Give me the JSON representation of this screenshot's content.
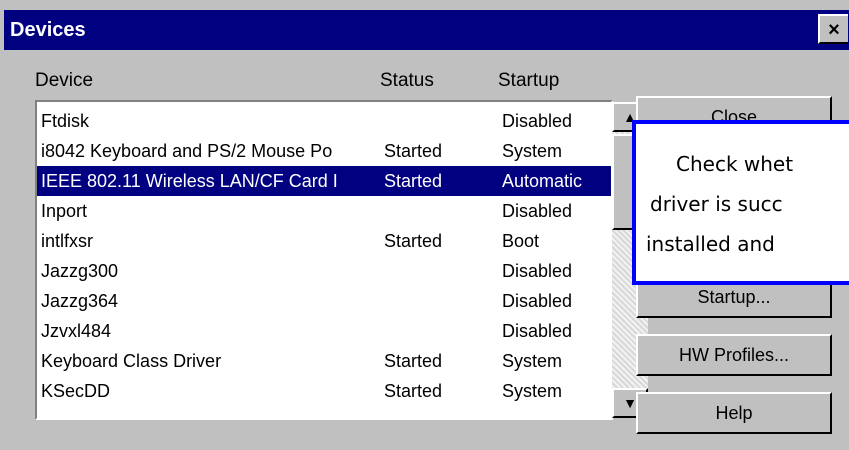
{
  "window": {
    "title": "Devices",
    "close_glyph": "×"
  },
  "columns": {
    "device": "Device",
    "status": "Status",
    "startup": "Startup"
  },
  "devices": [
    {
      "name": "Ftdisk",
      "status": "",
      "startup": "Disabled"
    },
    {
      "name": "i8042 Keyboard and PS/2 Mouse Po",
      "status": "Started",
      "startup": "System"
    },
    {
      "name": "IEEE 802.11 Wireless LAN/CF Card I",
      "status": "Started",
      "startup": "Automatic"
    },
    {
      "name": "Inport",
      "status": "",
      "startup": "Disabled"
    },
    {
      "name": "intlfxsr",
      "status": "Started",
      "startup": "Boot"
    },
    {
      "name": "Jazzg300",
      "status": "",
      "startup": "Disabled"
    },
    {
      "name": "Jazzg364",
      "status": "",
      "startup": "Disabled"
    },
    {
      "name": "Jzvxl484",
      "status": "",
      "startup": "Disabled"
    },
    {
      "name": "Keyboard Class Driver",
      "status": "Started",
      "startup": "System"
    },
    {
      "name": "KSecDD",
      "status": "Started",
      "startup": "System"
    }
  ],
  "selected_device": "IEEE 802.11 Wireless LAN/CF Card I",
  "buttons": {
    "close": "Close",
    "startup": "Startup...",
    "hw_profiles": "HW Profiles...",
    "help": "Help"
  },
  "callout": {
    "line1": "Check whet",
    "line2": "driver is succ",
    "line3": "installed and"
  },
  "colors": {
    "title_bar": "#000080",
    "selection": "#000080",
    "callout_border": "#0000ff",
    "face": "#c0c0c0"
  },
  "icons": {
    "scroll_up": "up-arrow-icon",
    "scroll_down": "down-arrow-icon",
    "close": "close-icon"
  }
}
